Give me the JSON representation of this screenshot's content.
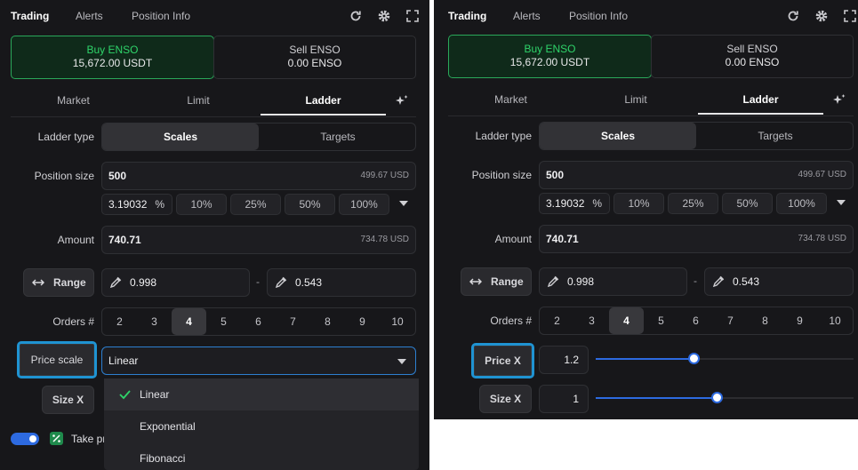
{
  "header": {
    "tabs": [
      "Trading",
      "Alerts",
      "Position Info"
    ]
  },
  "sides": {
    "buy": {
      "label": "Buy ENSO",
      "amount": "15,672.00 USDT"
    },
    "sell": {
      "label": "Sell ENSO",
      "amount": "0.00 ENSO"
    }
  },
  "order_tabs": [
    "Market",
    "Limit",
    "Ladder"
  ],
  "ladder_type": {
    "label": "Ladder type",
    "options": [
      "Scales",
      "Targets"
    ],
    "selected": "Scales"
  },
  "position_size": {
    "label": "Position size",
    "value": "500",
    "usd": "499.67 USD",
    "pct_value": "3.19032",
    "pct_symbol": "%",
    "pcts": [
      "10%",
      "25%",
      "50%",
      "100%"
    ]
  },
  "amount": {
    "label": "Amount",
    "value": "740.71",
    "usd": "734.78 USD"
  },
  "range": {
    "label": "Range",
    "low": "0.998",
    "high": "0.543",
    "sep": "-"
  },
  "orders": {
    "label": "Orders #",
    "options": [
      "2",
      "3",
      "4",
      "5",
      "6",
      "7",
      "8",
      "9",
      "10"
    ],
    "selected": "4"
  },
  "left": {
    "price_scale": {
      "label": "Price scale",
      "value": "Linear"
    },
    "size_x_label": "Size X",
    "dropdown": {
      "options": [
        "Linear",
        "Exponential",
        "Fibonacci"
      ],
      "selected": "Linear"
    },
    "take_profit_label": "Take pr"
  },
  "right": {
    "price_x": {
      "label": "Price X",
      "value": "1.2",
      "slider_fraction": 0.38
    },
    "size_x": {
      "label": "Size X",
      "value": "1",
      "slider_fraction": 0.47
    }
  },
  "colors": {
    "accent_blue": "#2d6ae0",
    "buy_green": "#2fd46a",
    "highlight": "#1f93d2",
    "bg": "#17171a"
  }
}
